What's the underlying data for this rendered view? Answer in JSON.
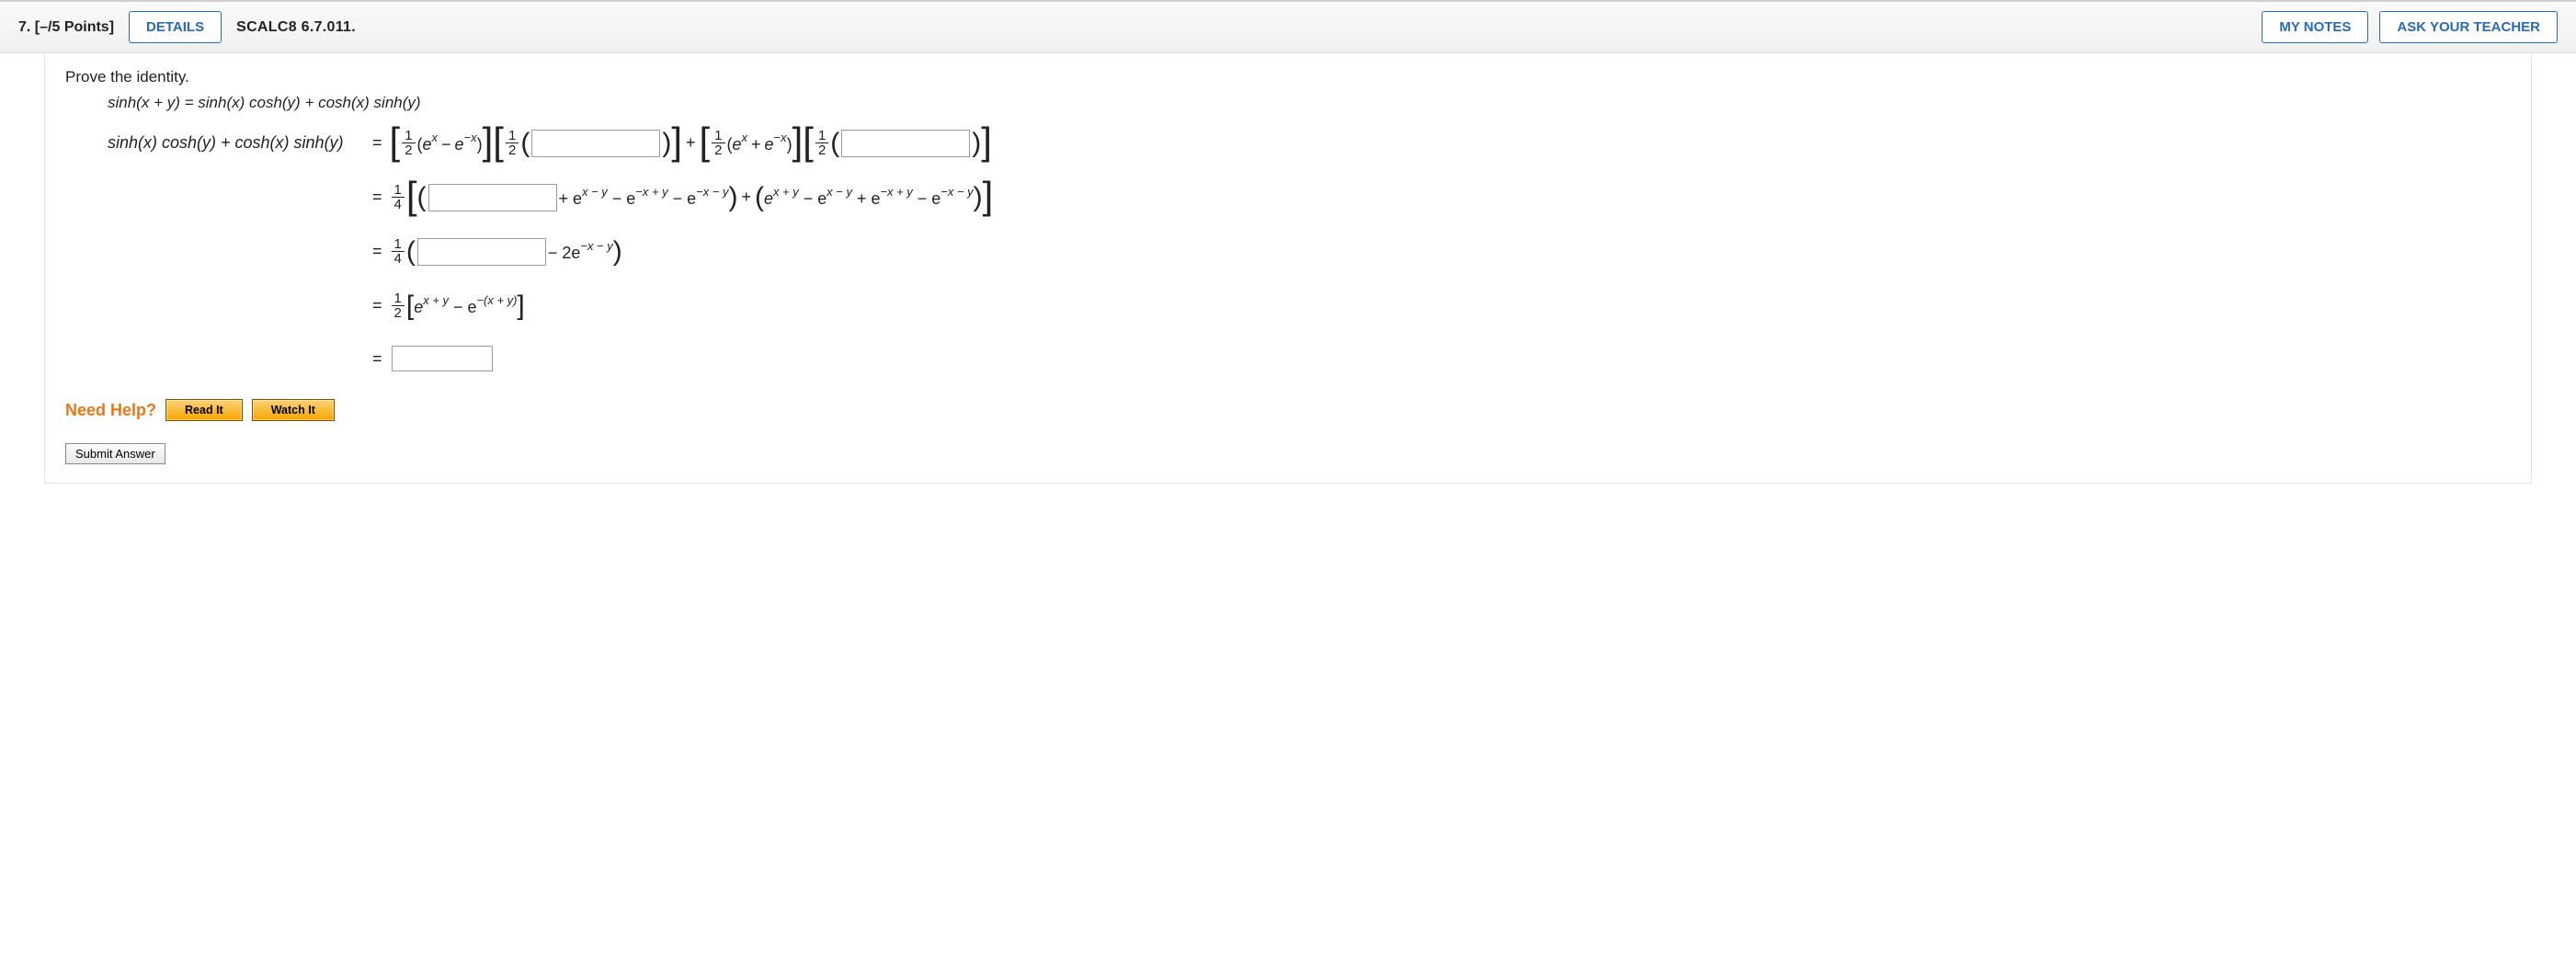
{
  "header": {
    "qnum": "7.",
    "points": "[–/5 Points]",
    "details_btn": "DETAILS",
    "refid": "SCALC8 6.7.011.",
    "mynotes_btn": "MY NOTES",
    "ask_btn": "ASK YOUR TEACHER"
  },
  "prompt": "Prove the identity.",
  "identity": "sinh(x + y) = sinh(x) cosh(y) + cosh(x) sinh(y)",
  "lhs": "sinh(x) cosh(y) + cosh(x) sinh(y)",
  "math": {
    "half_num": "1",
    "half_den": "2",
    "quarter_num": "1",
    "quarter_den": "4",
    "e": "e",
    "x": "x",
    "y": "y",
    "minus": "−",
    "plus": "+",
    "eq": "=",
    "two": "2"
  },
  "line2_tail_a": " + e",
  "line2_exp_a": "x − y",
  "line2_tail_b": " − e",
  "line2_exp_b": "−x + y",
  "line2_tail_c": " − e",
  "line2_exp_c": "−x − y",
  "line2_group2_a": "e",
  "line2_g2_exp_a": "x + y",
  "line2_g2_b": " − e",
  "line2_g2_exp_b": "x − y",
  "line2_g2_c": " + e",
  "line2_g2_exp_c": "−x + y",
  "line2_g2_d": " − e",
  "line2_g2_exp_d": "−x − y",
  "line3_tail": " − 2e",
  "line3_exp": "−x − y",
  "line4_a": "e",
  "line4_exp_a": "x + y",
  "line4_b": " − e",
  "line4_exp_b": "−(x + y)",
  "help": {
    "label": "Need Help?",
    "read": "Read It",
    "watch": "Watch It"
  },
  "submit": "Submit Answer"
}
